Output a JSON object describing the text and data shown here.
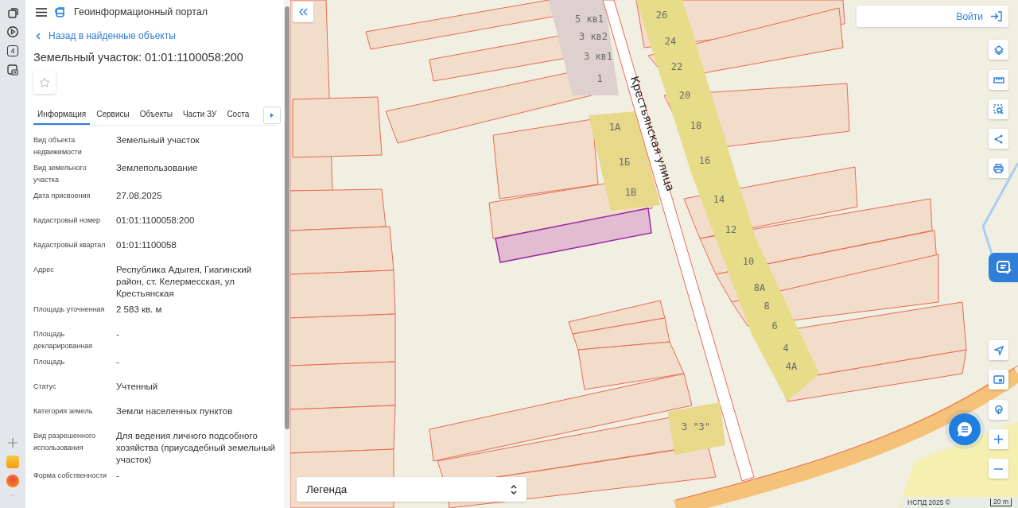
{
  "rail": {
    "key_label": "4"
  },
  "header": {
    "title": "Геоинформационный портал"
  },
  "back_link": "Назад в найденные объекты",
  "object_title": "Земельный участок: 01:01:1100058:200",
  "tabs": [
    {
      "label": "Информация",
      "selected": true
    },
    {
      "label": "Сервисы",
      "selected": false
    },
    {
      "label": "Объекты",
      "selected": false
    },
    {
      "label": "Части ЗУ",
      "selected": false
    },
    {
      "label": "Соста",
      "selected": false
    }
  ],
  "fields": [
    {
      "label": "Вид объекта недвижимости",
      "value": "Земельный участок"
    },
    {
      "label": "Вид земельного участка",
      "value": "Землепользование"
    },
    {
      "label": "Дата присвоения",
      "value": "27.08.2025"
    },
    {
      "label": "Кадастровый номер",
      "value": "01:01:1100058:200"
    },
    {
      "label": "Кадастровый квартал",
      "value": "01:01:1100058"
    },
    {
      "label": "Адрес",
      "value": "Республика Адыгея, Гиагинский район, ст. Келермесская, ул Крестьянская"
    },
    {
      "label": "Площадь уточненная",
      "value": "2 583 кв. м"
    },
    {
      "label": "Площадь декларированная",
      "value": "-"
    },
    {
      "label": "Площадь",
      "value": "-"
    },
    {
      "label": "Статус",
      "value": "Учтенный"
    },
    {
      "label": "Категория земель",
      "value": "Земли населенных пунктов"
    },
    {
      "label": "Вид разрешенного использования",
      "value": "Для ведения личного подсобного хозяйства (приусадебный земельный участок)"
    },
    {
      "label": "Форма собственности",
      "value": "-"
    }
  ],
  "map": {
    "street": "Крестьянская улица",
    "house_numbers": [
      "5 кв1",
      "3 кв2",
      "3 кв1",
      "1",
      "1А",
      "1Б",
      "1В",
      "26",
      "24",
      "22",
      "20",
      "18",
      "16",
      "14",
      "12",
      "10",
      "8А",
      "8",
      "6",
      "4",
      "4А",
      "3 \"3\""
    ],
    "login": "Войти",
    "legend": "Легенда",
    "attribution": "НСПД 2025 ©",
    "scale": "20 m"
  }
}
